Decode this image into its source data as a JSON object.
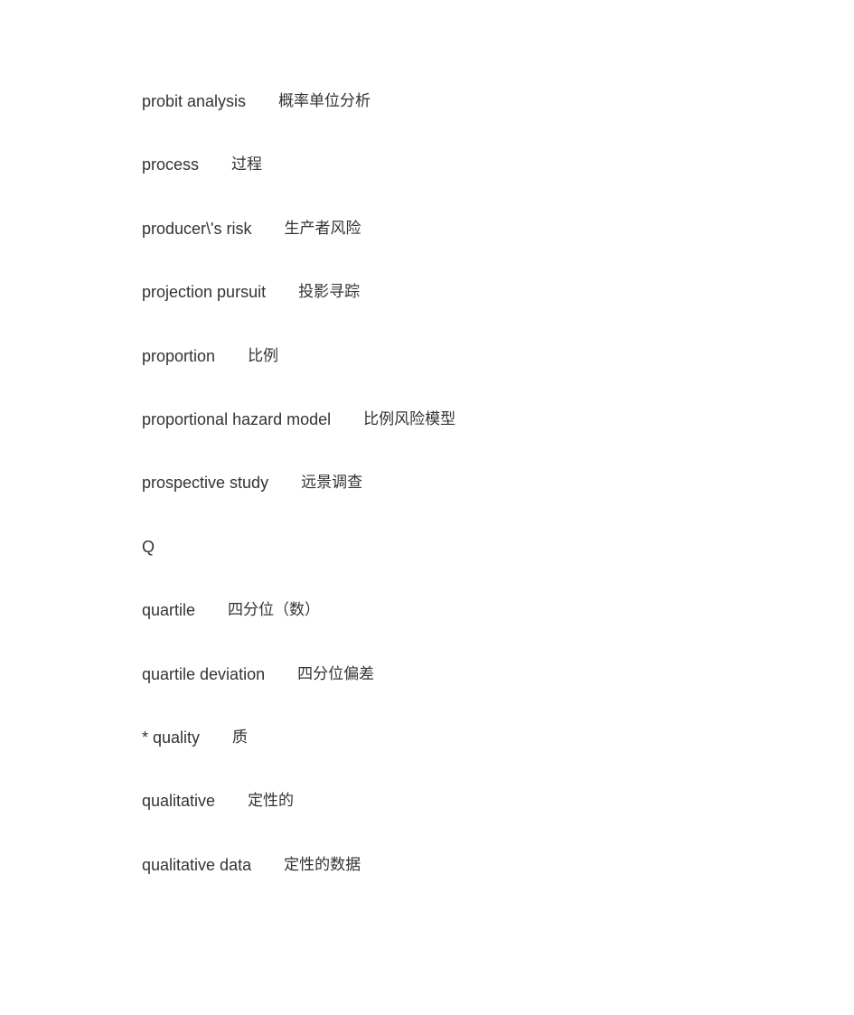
{
  "document": {
    "entries": [
      {
        "term": "probit analysis",
        "translation": "概率单位分析"
      },
      {
        "term": "process",
        "translation": "过程"
      },
      {
        "term": "producer\\'s risk",
        "translation": "生产者风险"
      },
      {
        "term": "projection pursuit",
        "translation": "投影寻踪"
      },
      {
        "term": "proportion",
        "translation": "比例"
      },
      {
        "term": "proportional hazard model",
        "translation": "比例风险模型"
      },
      {
        "term": "prospective study",
        "translation": "远景调查"
      },
      {
        "term": "Q",
        "translation": ""
      },
      {
        "term": "quartile",
        "translation": "四分位（数）"
      },
      {
        "term": "quartile deviation",
        "translation": "四分位偏差"
      },
      {
        "term": "* quality",
        "translation": "质"
      },
      {
        "term": "qualitative",
        "translation": "定性的"
      },
      {
        "term": "qualitative data",
        "translation": "定性的数据"
      }
    ]
  }
}
